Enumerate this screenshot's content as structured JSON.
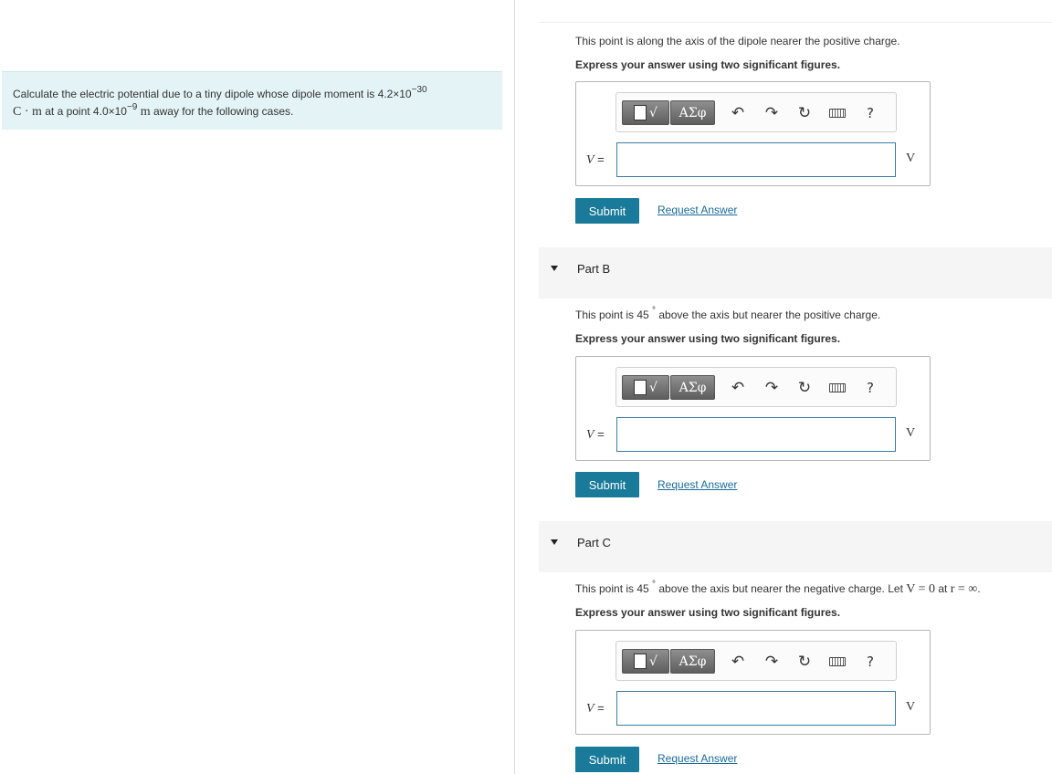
{
  "problem": {
    "intro": "Calculate the electric potential due to a tiny dipole whose dipole moment is 4.2×10",
    "exp1": "−30",
    "unit1": "C · m",
    "mid": " at a point 4.0×10",
    "exp2": "−9",
    "unit2": "m",
    "tail": " away for the following cases."
  },
  "toolbar": {
    "templates_sqrt": "√",
    "greek_label": "ΑΣφ",
    "undo_icon": "undo-icon",
    "redo_icon": "redo-icon",
    "reset_icon": "reset-icon",
    "keyboard_icon": "keyboard-icon",
    "help_label": "?"
  },
  "common": {
    "instruction": "Express your answer using two significant figures.",
    "var_label": "V",
    "eq": " =",
    "unit": "V",
    "submit_label": "Submit",
    "request_label": "Request Answer"
  },
  "partA": {
    "prompt": "This point is along the axis of the dipole nearer the positive charge.",
    "input_value": ""
  },
  "partB": {
    "title": "Part B",
    "prompt_pre": "This point is 45 ",
    "prompt_deg": "°",
    "prompt_post": " above the axis but nearer the positive charge.",
    "input_value": ""
  },
  "partC": {
    "title": "Part C",
    "prompt_pre": "This point is 45 ",
    "prompt_deg": "°",
    "prompt_mid": " above the axis but nearer the negative charge. Let ",
    "prompt_eq": "V = 0",
    "prompt_at": " at ",
    "prompt_r": "r = ∞",
    "prompt_end": ".",
    "input_value": ""
  },
  "colors": {
    "accent": "#1a7a9a",
    "problem_bg": "#e4f4f6",
    "input_border": "#3a7ca5",
    "link": "#1a6b9a"
  }
}
